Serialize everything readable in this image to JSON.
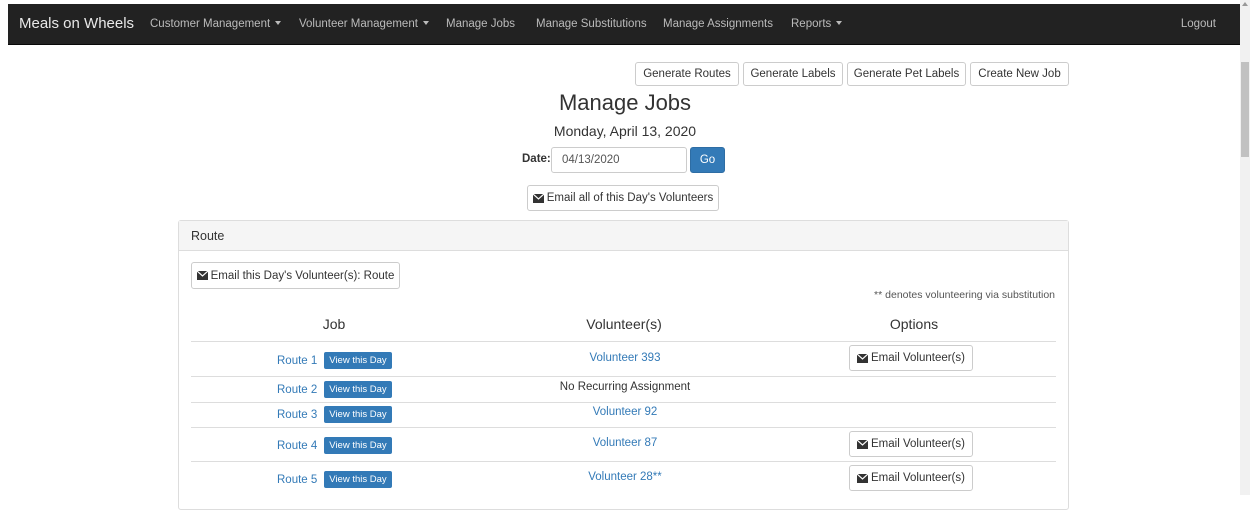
{
  "navbar": {
    "brand": "Meals on Wheels",
    "items": [
      {
        "label": "Customer Management",
        "dropdown": true
      },
      {
        "label": "Volunteer Management",
        "dropdown": true
      },
      {
        "label": "Manage Jobs",
        "dropdown": false
      },
      {
        "label": "Manage Substitutions",
        "dropdown": false
      },
      {
        "label": "Manage Assignments",
        "dropdown": false
      },
      {
        "label": "Reports",
        "dropdown": true
      }
    ],
    "logout": "Logout"
  },
  "toolbar": {
    "generate_routes": "Generate Routes",
    "generate_labels": "Generate Labels",
    "generate_pet_labels": "Generate Pet Labels",
    "create_new_job": "Create New Job"
  },
  "page": {
    "title": "Manage Jobs",
    "date_long": "Monday, April 13, 2020",
    "date_label": "Date:",
    "date_value": "04/13/2020",
    "go": "Go",
    "email_all": "Email all of this Day's Volunteers"
  },
  "panel": {
    "heading": "Route",
    "email_route": "Email this Day's Volunteer(s): Route",
    "note": "** denotes volunteering via substitution",
    "columns": {
      "job": "Job",
      "volunteers": "Volunteer(s)",
      "options": "Options"
    },
    "rows": [
      {
        "job": "Route 1",
        "view": "View this Day",
        "volunteer": "Volunteer 393",
        "volunteer_link": true,
        "option": "Email Volunteer(s)"
      },
      {
        "job": "Route 2",
        "view": "View this Day",
        "volunteer": "No Recurring Assignment",
        "volunteer_link": false,
        "option": ""
      },
      {
        "job": "Route 3",
        "view": "View this Day",
        "volunteer": "Volunteer 92",
        "volunteer_link": true,
        "option": ""
      },
      {
        "job": "Route 4",
        "view": "View this Day",
        "volunteer": "Volunteer 87",
        "volunteer_link": true,
        "option": "Email Volunteer(s)"
      },
      {
        "job": "Route 5",
        "view": "View this Day",
        "volunteer": "Volunteer 28**",
        "volunteer_link": true,
        "option": "Email Volunteer(s)"
      }
    ]
  },
  "colors": {
    "navbar_bg": "#222222",
    "primary": "#337ab7",
    "link": "#337ab7"
  },
  "icons": {
    "mail": "envelope-icon",
    "caret": "caret-down-icon"
  }
}
